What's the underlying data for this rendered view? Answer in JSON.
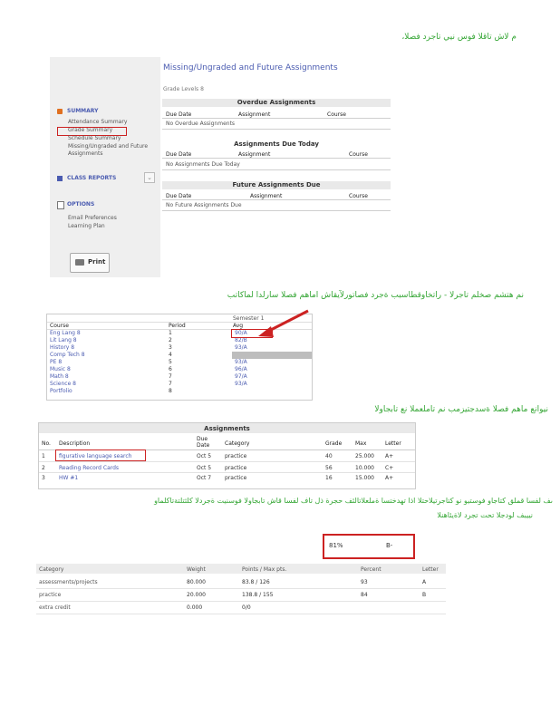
{
  "captions": {
    "c1": "م لاش تاقلا فوس نيي   تاجرد   فصلا،",
    "c2": "نم هتشم  صخلم تاجرلا  - راتخاوقطاسبب ةجرد  فصاتورلآيقاش اماهم  فصلا سارلدا لماكاتب",
    "c3": "نيوانع ماهم  فصلا ةسدجتيزمب  نم تاملعملا  نع تابجاولا",
    "c4a": "ىف لفسا قملق كتاجاو فوستيو نو كتاجرتيلاحتلا اذا  تهدختسا ةملعلاتالئف حجرة ذل تاف  لفسا  قاش تابجاولا فوسنيت ةجردلا كلثتلتةتاكلماو",
    "c4b": "نييبف لودجلا تحت تجرد لاةيئاهنلا"
  },
  "portal": {
    "title": "Missing/Ungraded and Future Assignments",
    "subtitle": "Grade Levels 8",
    "sidebar": {
      "summary_label": "SUMMARY",
      "summary_items": [
        "Attendance Summary",
        "Grade Summary",
        "Schedule Summary",
        "Missing/Ungraded and Future",
        "Assignments"
      ],
      "class_reports_label": "CLASS REPORTS",
      "options_label": "OPTIONS",
      "options_items": [
        "Email Preferences",
        "Learning Plan"
      ],
      "print_label": "Print"
    },
    "sections": [
      {
        "title": "Overdue Assignments",
        "cols": [
          "Due Date",
          "Assignment",
          "Course"
        ],
        "empty": "No Overdue Assignments"
      },
      {
        "title": "Assignments Due Today",
        "cols": [
          "Due Date",
          "Assignment",
          "Course"
        ],
        "empty": "No Assignments Due Today"
      },
      {
        "title": "Future Assignments Due",
        "cols": [
          "Due Date",
          "Assignment",
          "Course"
        ],
        "empty": "No Future Assignments Due"
      }
    ]
  },
  "grades": {
    "semester": "Semester 1",
    "cols": [
      "Course",
      "Period",
      "Avg"
    ],
    "rows": [
      [
        "Eng Lang 8",
        "1",
        "90/A"
      ],
      [
        "Lit Lang 8",
        "2",
        "82/B"
      ],
      [
        "History 8",
        "3",
        "93/A"
      ],
      [
        "Comp Tech 8",
        "4",
        ""
      ],
      [
        "PE 8",
        "5",
        "93/A"
      ],
      [
        "Music 8",
        "6",
        "96/A"
      ],
      [
        "Math 8",
        "7",
        "97/A"
      ],
      [
        "Science 8",
        "7",
        "93/A"
      ],
      [
        "Portfolio",
        "8",
        ""
      ]
    ]
  },
  "assignments": {
    "title": "Assignments",
    "cols": [
      "No.",
      "Description",
      "Due Date",
      "Category",
      "Grade",
      "Max",
      "Letter"
    ],
    "rows": [
      [
        "1",
        "figurative language search",
        "Oct 5",
        "practice",
        "40",
        "25.000",
        "A+"
      ],
      [
        "2",
        "Reading Record Cards",
        "Oct 5",
        "practice",
        "56",
        "10.000",
        "C+"
      ],
      [
        "3",
        "HW #1",
        "Oct 7",
        "practice",
        "16",
        "15.000",
        "A+"
      ]
    ]
  },
  "final": {
    "percent": "81%",
    "letter": "B-",
    "cols": [
      "Category",
      "Weight",
      "Points / Max pts.",
      "Percent",
      "Letter"
    ],
    "rows": [
      [
        "assessments/projects",
        "80.000",
        "83.8 / 126",
        "93",
        "A"
      ],
      [
        "practice",
        "20.000",
        "138.8 / 155",
        "84",
        "B"
      ],
      [
        "extra credit",
        "0.000",
        "0/0",
        "",
        ""
      ]
    ]
  },
  "colors": {
    "green": "#35a635",
    "red": "#cc2222",
    "accent": "#4a5bb0"
  }
}
